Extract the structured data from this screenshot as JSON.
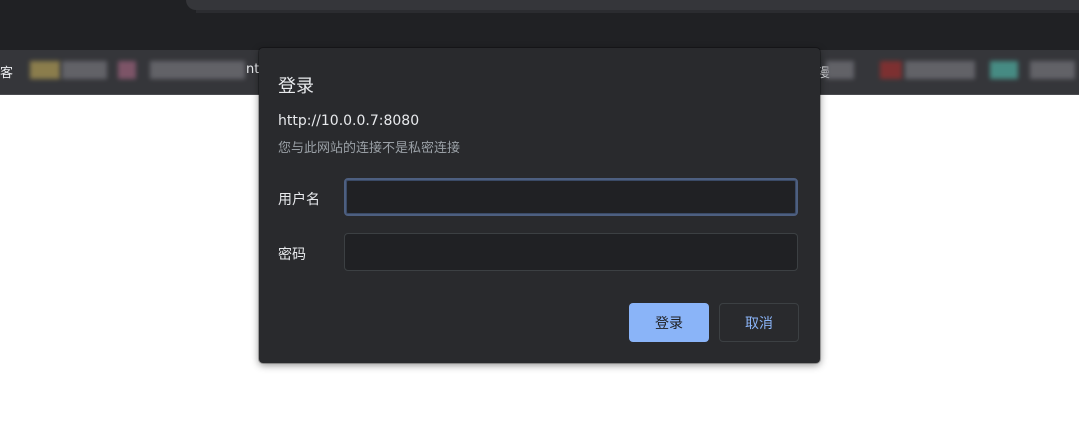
{
  "bookmarks": {
    "left_fragment": "客",
    "mid_fragment": "nt",
    "right_fragment": "漫"
  },
  "dialog": {
    "title": "登录",
    "origin": "http://10.0.0.7:8080",
    "privacy_note": "您与此网站的连接不是私密连接",
    "username_label": "用户名",
    "username_value": "",
    "password_label": "密码",
    "password_value": "",
    "login_button": "登录",
    "cancel_button": "取消"
  },
  "colors": {
    "dialog_bg": "#292a2d",
    "accent": "#8ab4f8",
    "chrome_bg": "#35363a"
  }
}
